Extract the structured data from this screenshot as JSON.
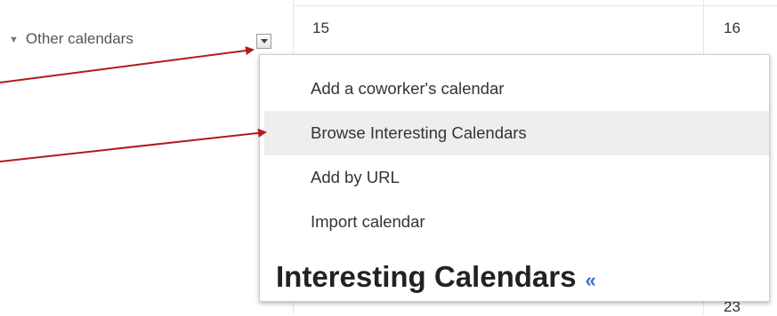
{
  "calendar": {
    "days": [
      "15",
      "16",
      "23"
    ]
  },
  "sidebar": {
    "other_calendars_label": "Other calendars"
  },
  "menu": {
    "items": [
      {
        "label": "Add a coworker's calendar",
        "highlighted": false
      },
      {
        "label": "Browse Interesting Calendars",
        "highlighted": true
      },
      {
        "label": "Add by URL",
        "highlighted": false
      },
      {
        "label": "Import calendar",
        "highlighted": false
      }
    ]
  },
  "tooltip": {
    "title": "Interesting Calendars",
    "chevron": "«"
  },
  "annotation": {
    "arrow_color": "#b01b1b"
  }
}
